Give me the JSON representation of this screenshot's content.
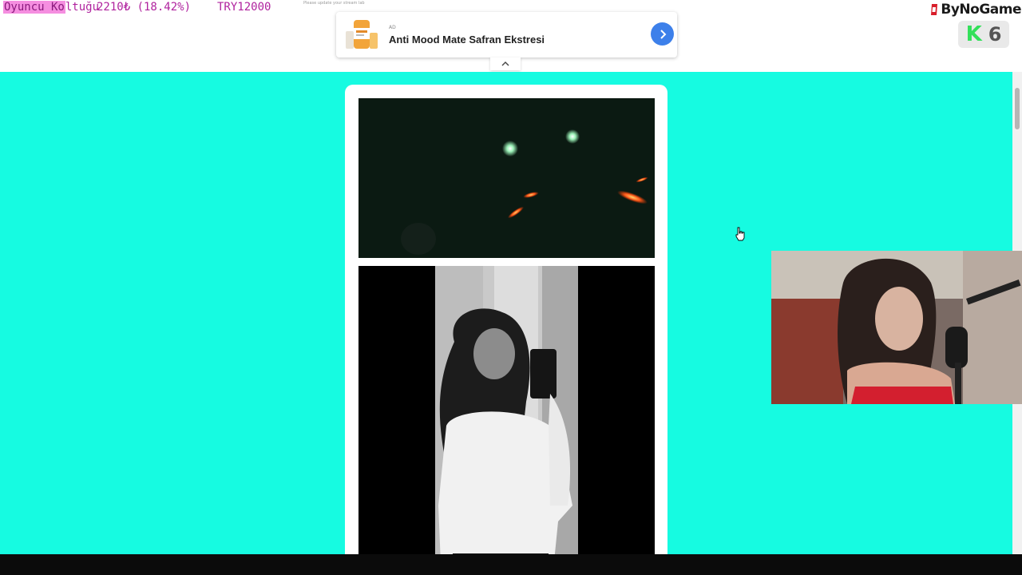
{
  "overlay": {
    "goal_name_highlight": "Oyuncu Ko",
    "goal_name_rest": "ltuğu",
    "goal_progress": "2210₺ (18.42%)",
    "goal_target": "TRY12000",
    "tiny_note": "Please update your stream lab",
    "brand": "ByNoGame",
    "badge_number": "6"
  },
  "ad": {
    "tag": "AD",
    "title": "Anti Mood Mate Safran Ekstresi",
    "button_icon": "chevron-right-icon",
    "collapse_icon": "chevron-up-icon"
  },
  "colors": {
    "page_background": "#16fbe1",
    "goal_text": "#b0239e",
    "goal_highlight": "#f58ee0",
    "ad_button": "#3d80ea",
    "kick_green": "#33e05a"
  }
}
